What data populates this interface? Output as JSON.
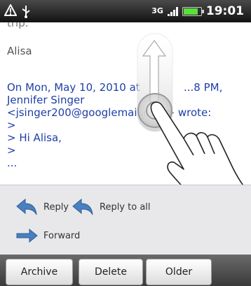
{
  "status_bar": {
    "network": "3G",
    "time": "19:01",
    "battery_level": 0.85,
    "icons": [
      "warning-icon",
      "usb-icon",
      "signal-icon",
      "battery-icon"
    ]
  },
  "message": {
    "cut_line": "trip.",
    "sender_sign": "Alisa",
    "quote_lines": [
      "On Mon, May 10, 2010 at",
      "...8 PM,",
      "Jennifer Singer",
      "<jsinger200@googlemail.com> wrote:",
      ">",
      "> Hi Alisa,",
      ">",
      "..."
    ]
  },
  "actions": {
    "reply": "Reply",
    "reply_all": "Reply to all",
    "forward": "Forward"
  },
  "bottom_bar": {
    "archive": "Archive",
    "delete": "Delete",
    "older": "Older"
  },
  "colors": {
    "link_blue": "#1e3fa8",
    "reply_arrow": "#4a7fc1",
    "battery_green": "#5adf3c"
  }
}
